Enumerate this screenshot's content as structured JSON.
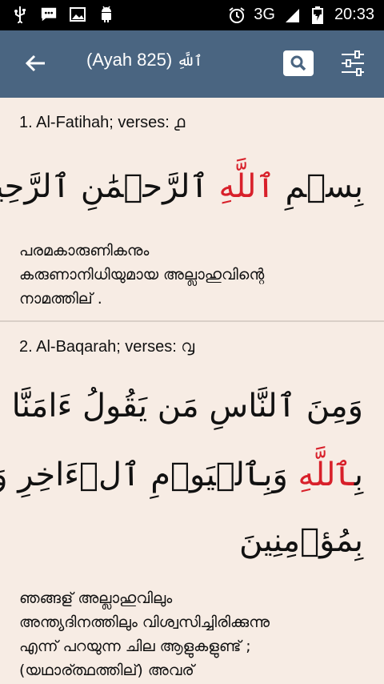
{
  "status": {
    "network": "3G",
    "time": "20:33",
    "icons": [
      "usb-icon",
      "message-icon",
      "image-icon",
      "android-icon",
      "alarm-icon",
      "signal-icon",
      "battery-icon"
    ]
  },
  "appbar": {
    "title": "(Ayah 825) ",
    "title_arabic": "ٱللَّهِ",
    "icons": [
      "back-arrow-icon",
      "search-icon",
      "filter-icon"
    ]
  },
  "results": [
    {
      "sura": "1. Al-Fatihah; verses: ",
      "sura_num": "൧",
      "arabic_lines": [
        {
          "pre": "بِسۡمِ ",
          "allah": "ٱللَّهِ",
          "post": " ٱلرَّحۡمَٰنِ ٱلرَّحِيمِ"
        }
      ],
      "translation_lines": [
        "പരമകാരുണികനും",
        "കരുണാനിധിയുമായ അല്ലാഹുവിന്റെ",
        "നാമത്തില് ."
      ]
    },
    {
      "sura": "2. Al-Baqarah; verses: ",
      "sura_num": "൮",
      "arabic_lines": [
        {
          "pre": "وَمِنَ ٱلنَّاسِ مَن يَقُولُ ءَامَنَّا",
          "allah": "",
          "post": ""
        },
        {
          "pre": "بِ",
          "allah": "ٱللَّهِ",
          "post": " وَبِٱلۡيَوۡمِ ٱلۡءَاخِرِ وَمَا هُم"
        },
        {
          "pre": "بِمُؤۡمِنِينَ",
          "allah": "",
          "post": ""
        }
      ],
      "translation_lines": [
        "ഞങ്ങള് അല്ലാഹുവിലും",
        "അന്ത്യദിനത്തിലും വിശ്വസിച്ചിരിക്കുന്നു",
        "എന്ന് പറയുന്ന ചില ആളുകളുണ്ട് ;",
        "(യഥാര്ത്ഥത്തില്) അവര്"
      ]
    }
  ]
}
